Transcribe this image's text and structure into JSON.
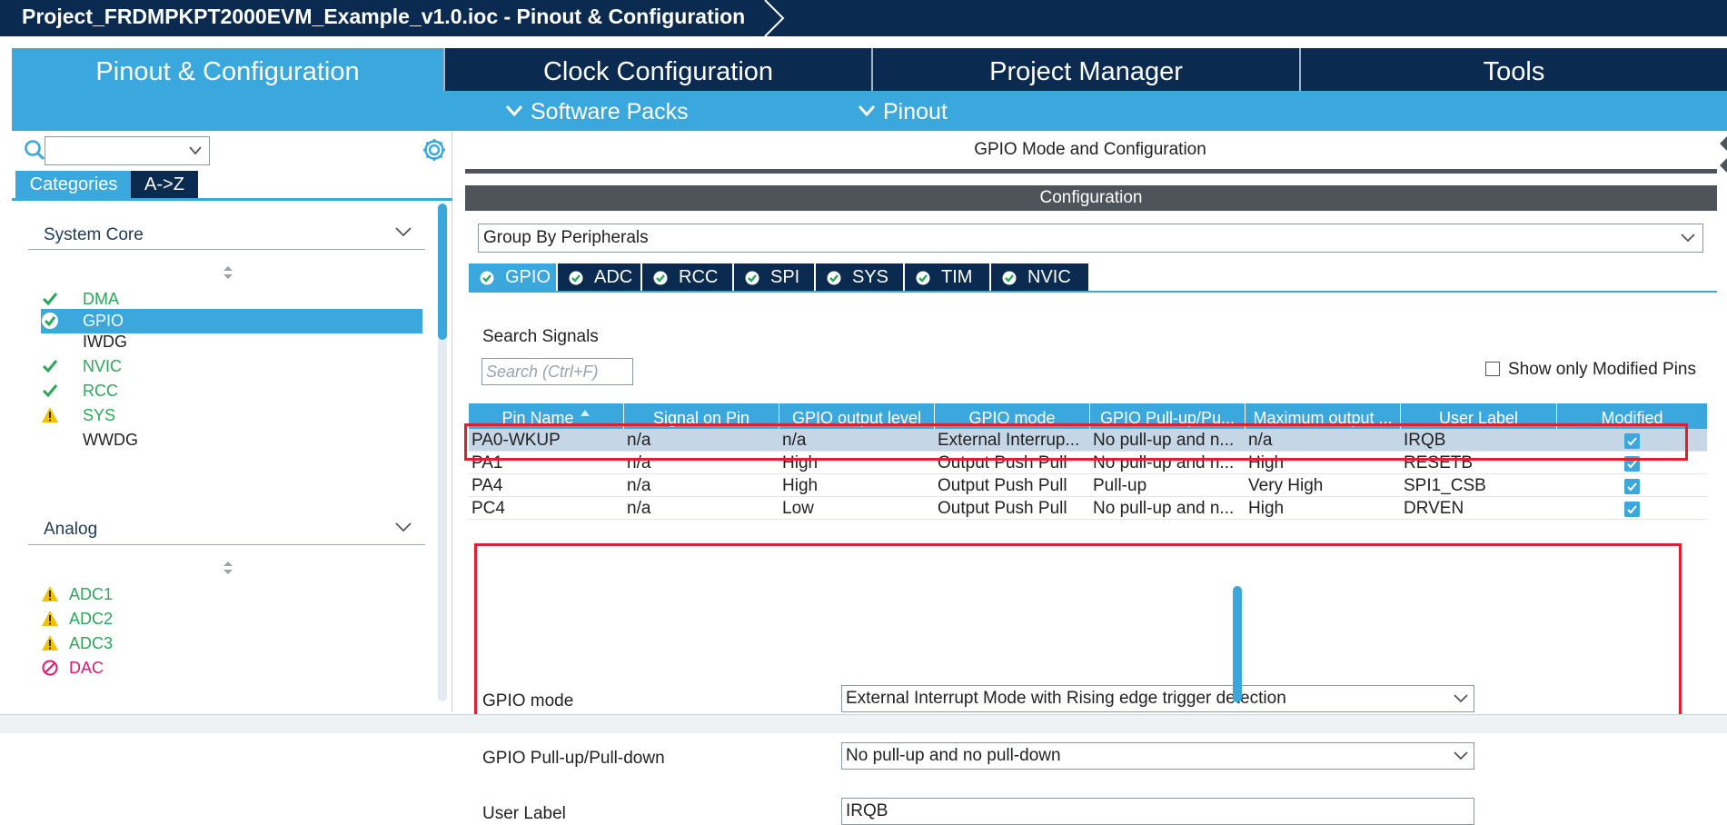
{
  "window": {
    "title": "Project_FRDMPKPT2000EVM_Example_v1.0.ioc - Pinout & Configuration"
  },
  "main_tabs": [
    {
      "label": "Pinout & Configuration",
      "active": true
    },
    {
      "label": "Clock Configuration",
      "active": false
    },
    {
      "label": "Project Manager",
      "active": false
    },
    {
      "label": "Tools",
      "active": false
    }
  ],
  "sub_menu": {
    "software_packs": "Software Packs",
    "pinout": "Pinout"
  },
  "left": {
    "tabs": {
      "categories": "Categories",
      "az": "A->Z"
    },
    "system_core": {
      "title": "System Core",
      "items": [
        {
          "label": "DMA",
          "status": "ok",
          "selected": false
        },
        {
          "label": "GPIO",
          "status": "ok",
          "selected": true
        },
        {
          "label": "IWDG",
          "status": "none",
          "selected": false
        },
        {
          "label": "NVIC",
          "status": "ok",
          "selected": false
        },
        {
          "label": "RCC",
          "status": "ok",
          "selected": false
        },
        {
          "label": "SYS",
          "status": "warning",
          "selected": false
        },
        {
          "label": "WWDG",
          "status": "none",
          "selected": false
        }
      ]
    },
    "analog": {
      "title": "Analog",
      "items": [
        {
          "label": "ADC1",
          "status": "warning"
        },
        {
          "label": "ADC2",
          "status": "warning"
        },
        {
          "label": "ADC3",
          "status": "warning"
        },
        {
          "label": "DAC",
          "status": "disabled"
        }
      ]
    }
  },
  "right": {
    "panel_title": "GPIO Mode and Configuration",
    "config_bar": "Configuration",
    "group_by": "Group By Peripherals",
    "peripheral_tabs": [
      "GPIO",
      "ADC",
      "RCC",
      "SPI",
      "SYS",
      "TIM",
      "NVIC"
    ],
    "search_label": "Search Signals",
    "search_placeholder": "Search (Ctrl+F)",
    "show_modified": "Show only Modified Pins",
    "table": {
      "headers": [
        "Pin Name",
        "Signal on Pin",
        "GPIO output level",
        "GPIO mode",
        "GPIO Pull-up/Pu...",
        "Maximum output ...",
        "User Label",
        "Modified"
      ],
      "rows": [
        {
          "pin": "PA0-WKUP",
          "signal": "n/a",
          "level": "n/a",
          "mode": "External Interrup...",
          "pull": "No pull-up and n...",
          "speed": "n/a",
          "label": "IRQB",
          "modified": true
        },
        {
          "pin": "PA1",
          "signal": "n/a",
          "level": "High",
          "mode": "Output Push Pull",
          "pull": "No pull-up and n...",
          "speed": "High",
          "label": "RESETB",
          "modified": true
        },
        {
          "pin": "PA4",
          "signal": "n/a",
          "level": "High",
          "mode": "Output Push Pull",
          "pull": "Pull-up",
          "speed": "Very High",
          "label": "SPI1_CSB",
          "modified": true
        },
        {
          "pin": "PC4",
          "signal": "n/a",
          "level": "Low",
          "mode": "Output Push Pull",
          "pull": "No pull-up and n...",
          "speed": "High",
          "label": "DRVEN",
          "modified": true
        }
      ]
    },
    "details": {
      "gpio_mode_label": "GPIO mode",
      "gpio_mode_value": "External Interrupt Mode with Rising edge trigger detection",
      "pull_label": "GPIO Pull-up/Pull-down",
      "pull_value": "No pull-up and no pull-down",
      "user_label_label": "User Label",
      "user_label_value": "IRQB"
    }
  },
  "colors": {
    "navy": "#0a2b4f",
    "accent_blue": "#3aa8dc",
    "ok_green": "#2aa85a",
    "warning_yellow": "#f2c200",
    "disabled_pink": "#e2176f",
    "highlight_red": "#e0202f"
  }
}
